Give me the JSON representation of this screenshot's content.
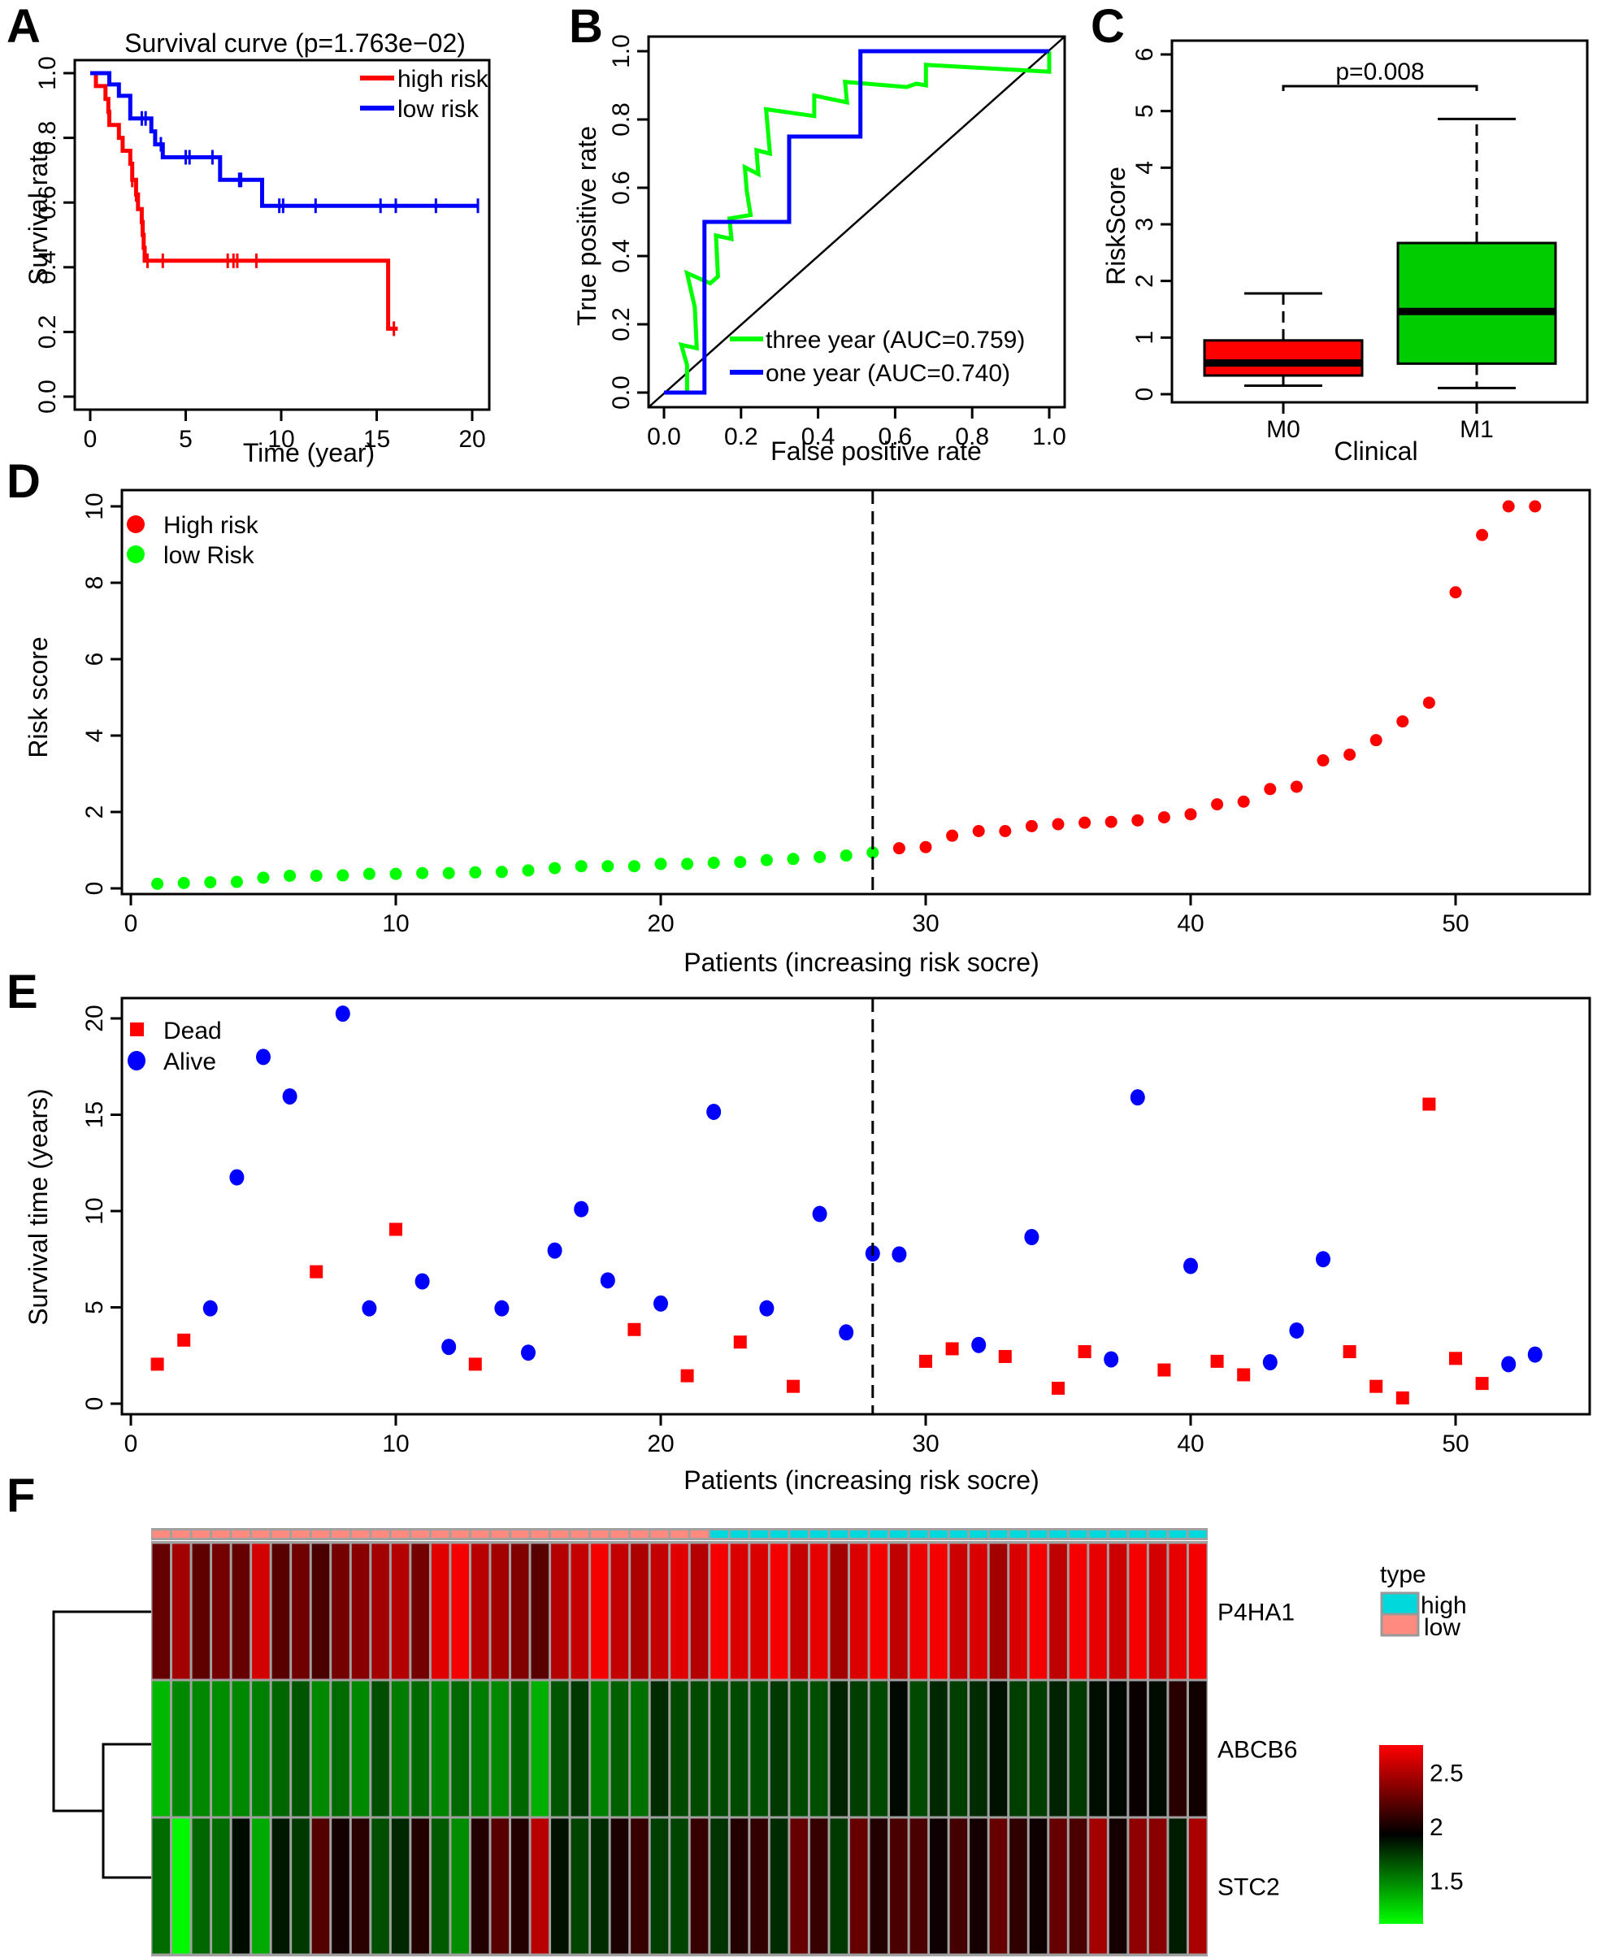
{
  "figure": {
    "panel_letters": [
      "A",
      "B",
      "C",
      "D",
      "E",
      "F"
    ]
  },
  "chart_data": [
    {
      "id": "A",
      "type": "line",
      "subtype": "kaplan-meier",
      "title": "Survival curve (p=1.763e−02)",
      "xlabel": "Time (year)",
      "ylabel": "Survival rate",
      "xlim": [
        0,
        20
      ],
      "ylim": [
        0,
        1
      ],
      "xticks": [
        "0",
        "5",
        "10",
        "15",
        "20"
      ],
      "yticks": [
        "0.0",
        "0.2",
        "0.4",
        "0.6",
        "0.8",
        "1.0"
      ],
      "legend_position": "top-right",
      "series": [
        {
          "name": "high risk",
          "color": "#ff0000",
          "steps": [
            [
              0,
              1.0
            ],
            [
              0.3,
              1.0
            ],
            [
              0.3,
              0.96
            ],
            [
              0.8,
              0.96
            ],
            [
              0.8,
              0.92
            ],
            [
              0.95,
              0.92
            ],
            [
              0.95,
              0.88
            ],
            [
              1.0,
              0.88
            ],
            [
              1.0,
              0.84
            ],
            [
              1.5,
              0.84
            ],
            [
              1.5,
              0.8
            ],
            [
              1.7,
              0.8
            ],
            [
              1.7,
              0.76
            ],
            [
              2.1,
              0.76
            ],
            [
              2.1,
              0.72
            ],
            [
              2.2,
              0.72
            ],
            [
              2.2,
              0.67
            ],
            [
              2.4,
              0.67
            ],
            [
              2.4,
              0.625
            ],
            [
              2.5,
              0.625
            ],
            [
              2.5,
              0.58
            ],
            [
              2.7,
              0.58
            ],
            [
              2.7,
              0.54
            ],
            [
              2.75,
              0.54
            ],
            [
              2.75,
              0.5
            ],
            [
              2.8,
              0.5
            ],
            [
              2.8,
              0.46
            ],
            [
              2.85,
              0.46
            ],
            [
              2.85,
              0.42
            ],
            [
              15.6,
              0.42
            ],
            [
              15.6,
              0.21
            ],
            [
              16.1,
              0.21
            ]
          ],
          "censor_times": [
            2.2,
            2.4,
            2.7,
            3.0,
            3.8,
            7.2,
            7.5,
            7.7,
            8.7,
            15.9
          ]
        },
        {
          "name": "low risk",
          "color": "#0000ff",
          "steps": [
            [
              0,
              1.0
            ],
            [
              1.0,
              1.0
            ],
            [
              1.0,
              0.965
            ],
            [
              1.5,
              0.965
            ],
            [
              1.5,
              0.93
            ],
            [
              2.1,
              0.93
            ],
            [
              2.1,
              0.86
            ],
            [
              3.2,
              0.86
            ],
            [
              3.2,
              0.82
            ],
            [
              3.4,
              0.82
            ],
            [
              3.4,
              0.78
            ],
            [
              3.8,
              0.78
            ],
            [
              3.8,
              0.74
            ],
            [
              6.8,
              0.74
            ],
            [
              6.8,
              0.67
            ],
            [
              9.0,
              0.67
            ],
            [
              9.0,
              0.59
            ],
            [
              20.3,
              0.59
            ]
          ],
          "censor_times": [
            2.7,
            2.9,
            3.7,
            5.0,
            5.2,
            6.4,
            7.8,
            7.9,
            9.9,
            10.1,
            11.8,
            15.2,
            16.0,
            18.1,
            20.3
          ]
        }
      ]
    },
    {
      "id": "B",
      "type": "line",
      "subtype": "roc",
      "title": "",
      "xlabel": "False positive rate",
      "ylabel": "True positive rate",
      "xlim": [
        0,
        1
      ],
      "ylim": [
        0,
        1
      ],
      "xticks": [
        "0.0",
        "0.2",
        "0.4",
        "0.6",
        "0.8",
        "1.0"
      ],
      "yticks": [
        "0.0",
        "0.2",
        "0.4",
        "0.6",
        "0.8",
        "1.0"
      ],
      "legend_position": "bottom-right",
      "diagonal": true,
      "series": [
        {
          "name": "three year (AUC=0.759)",
          "color": "#00ff00",
          "points": [
            [
              0.06,
              0.0
            ],
            [
              0.06,
              0.08
            ],
            [
              0.045,
              0.14
            ],
            [
              0.085,
              0.13
            ],
            [
              0.08,
              0.25
            ],
            [
              0.06,
              0.35
            ],
            [
              0.12,
              0.32
            ],
            [
              0.14,
              0.34
            ],
            [
              0.135,
              0.46
            ],
            [
              0.175,
              0.45
            ],
            [
              0.17,
              0.51
            ],
            [
              0.225,
              0.52
            ],
            [
              0.215,
              0.59
            ],
            [
              0.21,
              0.66
            ],
            [
              0.245,
              0.64
            ],
            [
              0.24,
              0.71
            ],
            [
              0.275,
              0.7
            ],
            [
              0.265,
              0.83
            ],
            [
              0.39,
              0.81
            ],
            [
              0.39,
              0.87
            ],
            [
              0.475,
              0.85
            ],
            [
              0.47,
              0.91
            ],
            [
              0.63,
              0.895
            ],
            [
              0.655,
              0.905
            ],
            [
              0.68,
              0.9
            ],
            [
              0.68,
              0.96
            ],
            [
              1.0,
              0.94
            ],
            [
              1.0,
              1.0
            ]
          ]
        },
        {
          "name": "one year (AUC=0.740)",
          "color": "#0000ff",
          "points": [
            [
              0.0,
              0.0
            ],
            [
              0.105,
              0.0
            ],
            [
              0.105,
              0.5
            ],
            [
              0.325,
              0.5
            ],
            [
              0.325,
              0.75
            ],
            [
              0.51,
              0.75
            ],
            [
              0.51,
              1.0
            ],
            [
              1.0,
              1.0
            ]
          ]
        }
      ]
    },
    {
      "id": "C",
      "type": "box",
      "title": "",
      "xlabel": "Clinical",
      "ylabel": "RiskScore",
      "ylim": [
        0,
        6
      ],
      "yticks": [
        "0",
        "1",
        "2",
        "3",
        "4",
        "5",
        "6"
      ],
      "annotation": "p=0.008",
      "categories": [
        "M0",
        "M1"
      ],
      "boxes": [
        {
          "name": "M0",
          "color": "#ff0000",
          "min": 0.15,
          "q1": 0.33,
          "median": 0.55,
          "q3": 0.95,
          "max": 1.78
        },
        {
          "name": "M1",
          "color": "#00cc00",
          "min": 0.11,
          "q1": 0.54,
          "median": 1.46,
          "q3": 2.67,
          "max": 4.86
        }
      ]
    },
    {
      "id": "D",
      "type": "scatter",
      "title": "",
      "xlabel": "Patients (increasing risk socre)",
      "ylabel": "Risk score",
      "xlim": [
        0,
        53
      ],
      "ylim": [
        0,
        10
      ],
      "xticks": [
        "0",
        "10",
        "20",
        "30",
        "40",
        "50"
      ],
      "yticks": [
        "0",
        "2",
        "4",
        "6",
        "8",
        "10"
      ],
      "cutoff_x": 28,
      "legend_position": "top-left",
      "legend": [
        {
          "name": "High risk",
          "color": "#ff0000"
        },
        {
          "name": "low Risk",
          "color": "#00ff00"
        }
      ],
      "values": [
        0.12,
        0.14,
        0.16,
        0.17,
        0.28,
        0.33,
        0.33,
        0.34,
        0.38,
        0.38,
        0.4,
        0.4,
        0.42,
        0.43,
        0.47,
        0.53,
        0.58,
        0.58,
        0.58,
        0.64,
        0.64,
        0.67,
        0.69,
        0.74,
        0.77,
        0.82,
        0.86,
        0.94,
        1.05,
        1.08,
        1.38,
        1.5,
        1.5,
        1.63,
        1.68,
        1.72,
        1.74,
        1.78,
        1.86,
        1.94,
        2.2,
        2.27,
        2.6,
        2.66,
        3.35,
        3.5,
        3.88,
        4.37,
        4.86,
        7.75,
        9.25,
        10.0,
        10.0
      ],
      "high_from_index": 28
    },
    {
      "id": "E",
      "type": "scatter",
      "title": "",
      "xlabel": "Patients (increasing risk socre)",
      "ylabel": "Survival time (years)",
      "xlim": [
        0,
        53
      ],
      "ylim": [
        0,
        20
      ],
      "xticks": [
        "0",
        "10",
        "20",
        "30",
        "40",
        "50"
      ],
      "yticks": [
        "0",
        "5",
        "10",
        "15",
        "20"
      ],
      "cutoff_x": 28,
      "legend_position": "top-left",
      "legend": [
        {
          "name": "Dead",
          "color": "#ff0000",
          "shape": "square"
        },
        {
          "name": "Alive",
          "color": "#0000ff",
          "shape": "circle"
        }
      ],
      "points": [
        {
          "x": 1,
          "y": 2.05,
          "status": "dead"
        },
        {
          "x": 2,
          "y": 3.3,
          "status": "dead"
        },
        {
          "x": 3,
          "y": 4.95,
          "status": "alive"
        },
        {
          "x": 4,
          "y": 11.75,
          "status": "alive"
        },
        {
          "x": 5,
          "y": 18.0,
          "status": "alive"
        },
        {
          "x": 6,
          "y": 15.95,
          "status": "alive"
        },
        {
          "x": 7,
          "y": 6.85,
          "status": "dead"
        },
        {
          "x": 8,
          "y": 20.25,
          "status": "alive"
        },
        {
          "x": 9,
          "y": 4.95,
          "status": "alive"
        },
        {
          "x": 10,
          "y": 9.05,
          "status": "dead"
        },
        {
          "x": 11,
          "y": 6.35,
          "status": "alive"
        },
        {
          "x": 12,
          "y": 2.95,
          "status": "alive"
        },
        {
          "x": 13,
          "y": 2.05,
          "status": "dead"
        },
        {
          "x": 14,
          "y": 4.95,
          "status": "alive"
        },
        {
          "x": 15,
          "y": 2.65,
          "status": "alive"
        },
        {
          "x": 16,
          "y": 7.95,
          "status": "alive"
        },
        {
          "x": 17,
          "y": 10.1,
          "status": "alive"
        },
        {
          "x": 18,
          "y": 6.4,
          "status": "alive"
        },
        {
          "x": 19,
          "y": 3.85,
          "status": "dead"
        },
        {
          "x": 20,
          "y": 5.2,
          "status": "alive"
        },
        {
          "x": 21,
          "y": 1.45,
          "status": "dead"
        },
        {
          "x": 22,
          "y": 15.15,
          "status": "alive"
        },
        {
          "x": 23,
          "y": 3.2,
          "status": "dead"
        },
        {
          "x": 24,
          "y": 4.95,
          "status": "alive"
        },
        {
          "x": 25,
          "y": 0.9,
          "status": "dead"
        },
        {
          "x": 26,
          "y": 9.85,
          "status": "alive"
        },
        {
          "x": 27,
          "y": 3.7,
          "status": "alive"
        },
        {
          "x": 28,
          "y": 7.8,
          "status": "alive"
        },
        {
          "x": 29,
          "y": 7.75,
          "status": "alive"
        },
        {
          "x": 30,
          "y": 2.2,
          "status": "dead"
        },
        {
          "x": 31,
          "y": 2.85,
          "status": "dead"
        },
        {
          "x": 32,
          "y": 3.05,
          "status": "alive"
        },
        {
          "x": 33,
          "y": 2.45,
          "status": "dead"
        },
        {
          "x": 34,
          "y": 8.65,
          "status": "alive"
        },
        {
          "x": 35,
          "y": 0.8,
          "status": "dead"
        },
        {
          "x": 36,
          "y": 2.7,
          "status": "dead"
        },
        {
          "x": 37,
          "y": 2.3,
          "status": "alive"
        },
        {
          "x": 38,
          "y": 15.9,
          "status": "alive"
        },
        {
          "x": 39,
          "y": 1.75,
          "status": "dead"
        },
        {
          "x": 40,
          "y": 7.15,
          "status": "alive"
        },
        {
          "x": 41,
          "y": 2.2,
          "status": "dead"
        },
        {
          "x": 42,
          "y": 1.5,
          "status": "dead"
        },
        {
          "x": 43,
          "y": 2.15,
          "status": "alive"
        },
        {
          "x": 44,
          "y": 3.8,
          "status": "alive"
        },
        {
          "x": 45,
          "y": 7.5,
          "status": "alive"
        },
        {
          "x": 46,
          "y": 2.7,
          "status": "dead"
        },
        {
          "x": 47,
          "y": 0.9,
          "status": "dead"
        },
        {
          "x": 48,
          "y": 0.3,
          "status": "dead"
        },
        {
          "x": 49,
          "y": 15.55,
          "status": "dead"
        },
        {
          "x": 50,
          "y": 2.35,
          "status": "dead"
        },
        {
          "x": 51,
          "y": 1.05,
          "status": "dead"
        },
        {
          "x": 52,
          "y": 2.05,
          "status": "alive"
        },
        {
          "x": 53,
          "y": 2.55,
          "status": "alive"
        }
      ]
    },
    {
      "id": "F",
      "type": "heatmap",
      "title": "",
      "rows": [
        "P4HA1",
        "ABCB6",
        "STC2"
      ],
      "n_columns": 53,
      "column_annotation": {
        "title": "type",
        "low_count": 28,
        "high_count": 25,
        "legend": [
          {
            "name": "high",
            "color": "#00d8dc"
          },
          {
            "name": "low",
            "color": "#ff8b80"
          }
        ]
      },
      "colorbar": {
        "ticks": [
          "2.5",
          "2",
          "1.5"
        ],
        "tick_values": [
          2.5,
          2.0,
          1.5
        ],
        "range": [
          1.1,
          2.75
        ],
        "low_color": "#00ff00",
        "mid_color": "#000000",
        "high_color": "#ff0000"
      },
      "dendrogram": "rows: ABCB6 and STC2 join first, then P4HA1",
      "values": [
        [
          2.3,
          2.48,
          2.28,
          2.34,
          2.3,
          2.62,
          2.26,
          2.33,
          2.22,
          2.34,
          2.4,
          2.48,
          2.53,
          2.34,
          2.66,
          2.72,
          2.54,
          2.48,
          2.38,
          2.26,
          2.53,
          2.58,
          2.72,
          2.58,
          2.5,
          2.58,
          2.66,
          2.53,
          2.72,
          2.64,
          2.64,
          2.72,
          2.58,
          2.68,
          2.48,
          2.64,
          2.72,
          2.56,
          2.7,
          2.72,
          2.6,
          2.64,
          2.48,
          2.64,
          2.72,
          2.56,
          2.72,
          2.68,
          2.6,
          2.72,
          2.62,
          2.68,
          2.72
        ],
        [
          1.35,
          1.52,
          1.52,
          1.5,
          1.52,
          1.55,
          1.64,
          1.7,
          1.52,
          1.62,
          1.52,
          1.72,
          1.56,
          1.63,
          1.53,
          1.63,
          1.56,
          1.52,
          1.64,
          1.38,
          1.7,
          1.8,
          1.55,
          1.66,
          1.6,
          1.85,
          1.74,
          1.74,
          1.74,
          1.74,
          1.72,
          1.8,
          1.74,
          1.72,
          1.88,
          1.78,
          1.75,
          1.97,
          1.74,
          1.86,
          1.78,
          1.85,
          1.94,
          1.78,
          1.78,
          1.88,
          1.8,
          1.95,
          1.98,
          2.03,
          1.96,
          2.12,
          2.05
        ],
        [
          1.62,
          1.12,
          1.64,
          1.62,
          1.96,
          1.4,
          1.92,
          1.8,
          2.24,
          2.06,
          2.12,
          1.72,
          1.86,
          2.1,
          1.68,
          1.5,
          2.1,
          2.26,
          2.1,
          2.54,
          1.94,
          1.76,
          1.85,
          2.08,
          2.16,
          1.78,
          1.76,
          2.16,
          1.82,
          2.1,
          2.15,
          1.85,
          2.3,
          2.16,
          1.8,
          2.3,
          2.1,
          2.22,
          2.22,
          2.04,
          2.2,
          2.06,
          2.3,
          2.14,
          2.04,
          2.3,
          2.22,
          2.48,
          2.06,
          2.42,
          2.4,
          1.9,
          2.5
        ]
      ]
    }
  ]
}
